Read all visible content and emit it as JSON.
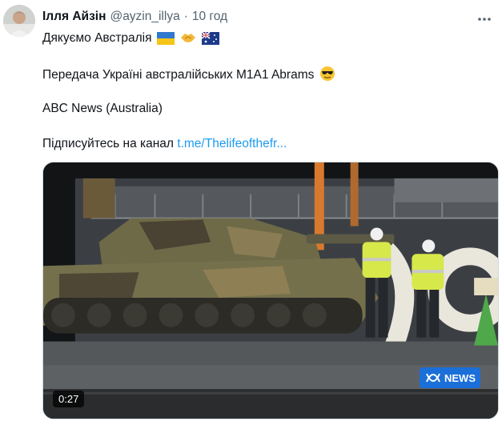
{
  "author": {
    "name": "Ілля Айзін",
    "handle": "@ayzin_illya",
    "separator": "·",
    "time": "10 год"
  },
  "icons": {
    "more": "more-horizontal-icon",
    "avatar": "avatar",
    "flag_ua": "ukraine-flag-icon",
    "handshake": "handshake-icon",
    "flag_au": "australia-flag-icon",
    "sunglasses": "sunglasses-emoji-icon"
  },
  "tweet": {
    "line1": "Дякуємо Австралія",
    "line2": "Передача Україні австралійських M1A1 Abrams",
    "line3": "ABC News (Australia)",
    "line4_text": "Підписуйтесь на канал",
    "line4_link": "t.me/Thelifeofthefr..."
  },
  "media": {
    "duration": "0:27",
    "badge_text": "NEWS"
  },
  "colors": {
    "link": "#1d9bf0",
    "secondary_text": "#536471",
    "badge": "#1b6fd8"
  }
}
